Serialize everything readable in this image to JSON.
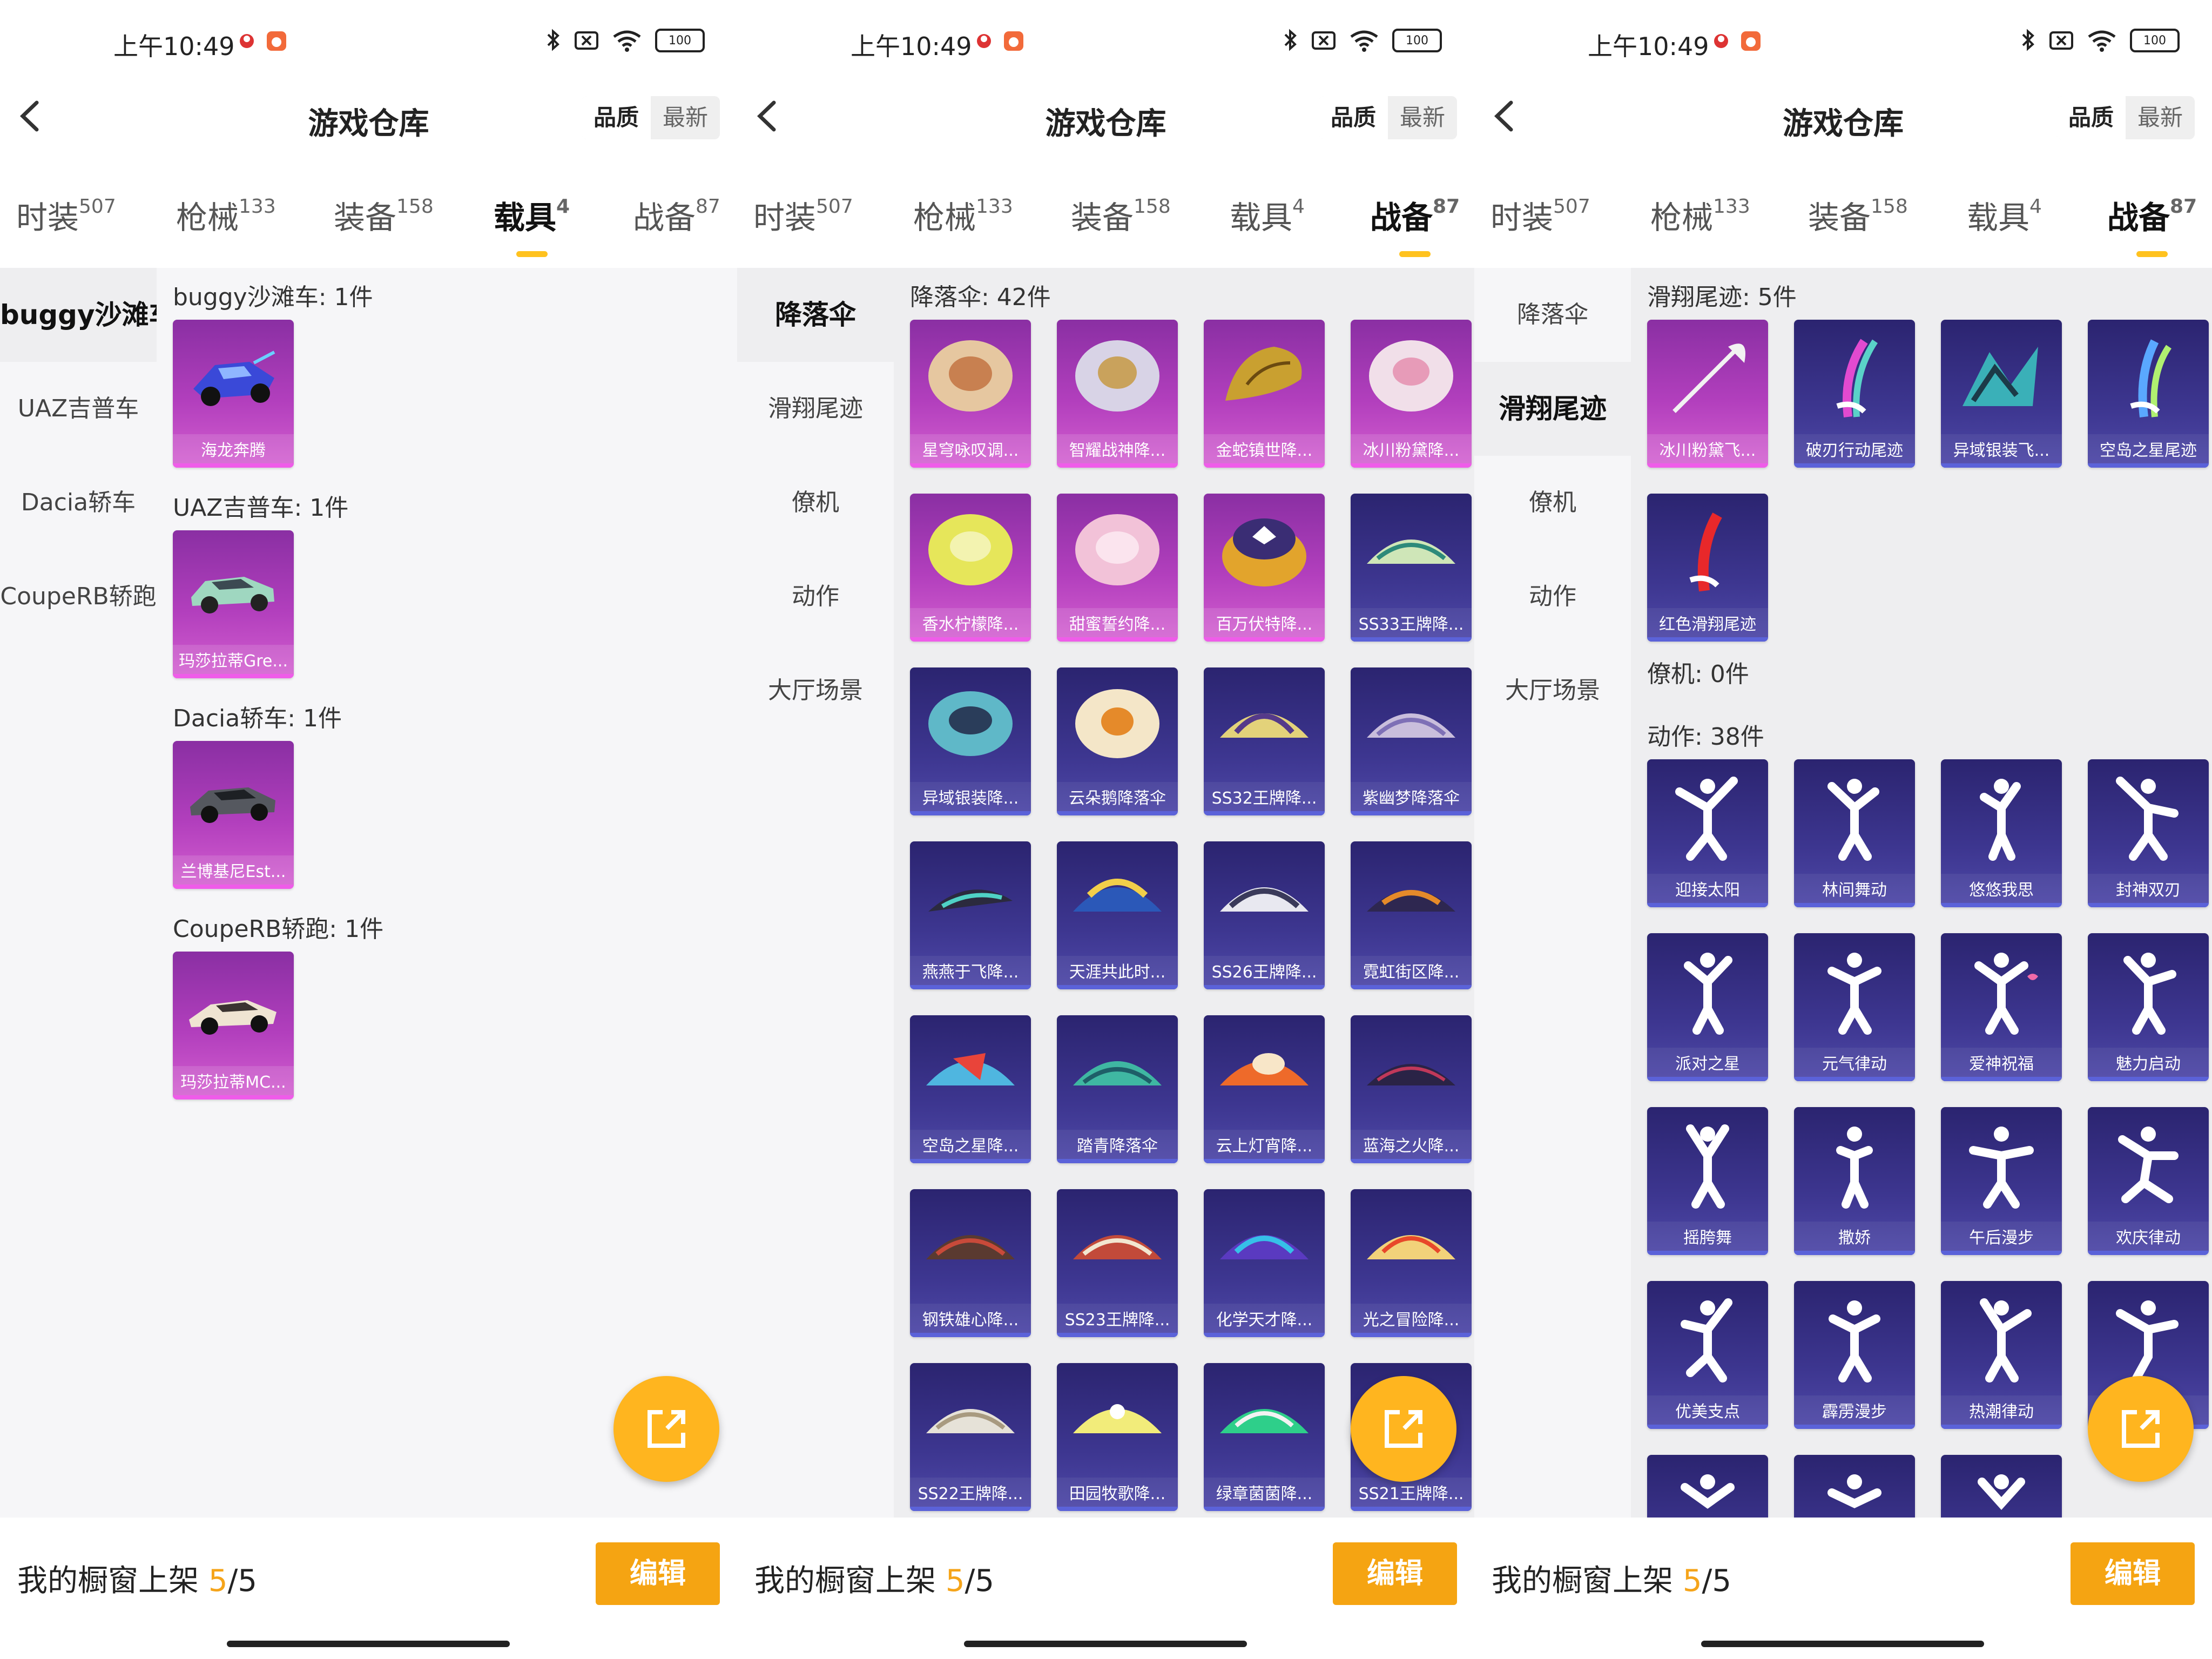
{
  "status": {
    "time": "上午10:49",
    "battery": "100"
  },
  "header": {
    "title": "游戏仓库",
    "sort_quality": "品质",
    "sort_latest": "最新"
  },
  "categories": [
    {
      "label": "时装",
      "count": "507"
    },
    {
      "label": "枪械",
      "count": "133"
    },
    {
      "label": "装备",
      "count": "158"
    },
    {
      "label": "载具",
      "count": "4"
    },
    {
      "label": "战备",
      "count": "87"
    }
  ],
  "footer": {
    "text": "我的橱窗上架",
    "shown": "5",
    "sep": "/",
    "total": "5",
    "edit": "编辑"
  },
  "panel1": {
    "sidebar": [
      "buggy沙滩车",
      "UAZ吉普车",
      "Dacia轿车",
      "CoupeRB轿跑"
    ],
    "sections": [
      {
        "title": "buggy沙滩车: 1件",
        "items": [
          "海龙奔腾"
        ]
      },
      {
        "title": "UAZ吉普车: 1件",
        "items": [
          "玛莎拉蒂Gre..."
        ]
      },
      {
        "title": "Dacia轿车: 1件",
        "items": [
          "兰博基尼Est..."
        ]
      },
      {
        "title": "CoupeRB轿跑: 1件",
        "items": [
          "玛莎拉蒂MC..."
        ]
      }
    ]
  },
  "panel2": {
    "sidebar": [
      "降落伞",
      "滑翔尾迹",
      "僚机",
      "动作",
      "大厅场景"
    ],
    "section_title": "降落伞: 42件",
    "items": [
      "星穹咏叹调...",
      "智耀战神降...",
      "金蛇镇世降...",
      "冰川粉黛降...",
      "香水柠檬降...",
      "甜蜜誓约降...",
      "百万伏特降...",
      "SS33王牌降...",
      "异域银装降...",
      "云朵鹅降落伞",
      "SS32王牌降...",
      "紫幽梦降落伞",
      "燕燕于飞降...",
      "天涯共此时...",
      "SS26王牌降...",
      "霓虹街区降...",
      "空岛之星降...",
      "踏青降落伞",
      "云上灯宵降...",
      "蓝海之火降...",
      "钢铁雄心降...",
      "SS23王牌降...",
      "化学天才降...",
      "光之冒险降...",
      "SS22王牌降...",
      "田园牧歌降...",
      "绿章菌菌降...",
      "SS21王牌降..."
    ]
  },
  "panel3": {
    "sidebar": [
      "降落伞",
      "滑翔尾迹",
      "僚机",
      "动作",
      "大厅场景"
    ],
    "trail_title": "滑翔尾迹: 5件",
    "trails": [
      "冰川粉黛飞...",
      "破刃行动尾迹",
      "异域银装飞...",
      "空岛之星尾迹",
      "红色滑翔尾迹"
    ],
    "wingman_title": "僚机: 0件",
    "action_title": "动作: 38件",
    "actions": [
      "迎接太阳",
      "林间舞动",
      "悠悠我思",
      "封神双刃",
      "派对之星",
      "元气律动",
      "爱神祝福",
      "魅力启动",
      "摇胯舞",
      "撒娇",
      "午后漫步",
      "欢庆律动",
      "优美支点",
      "霹雳漫步",
      "热潮律动",
      "",
      "",
      "",
      ""
    ]
  }
}
